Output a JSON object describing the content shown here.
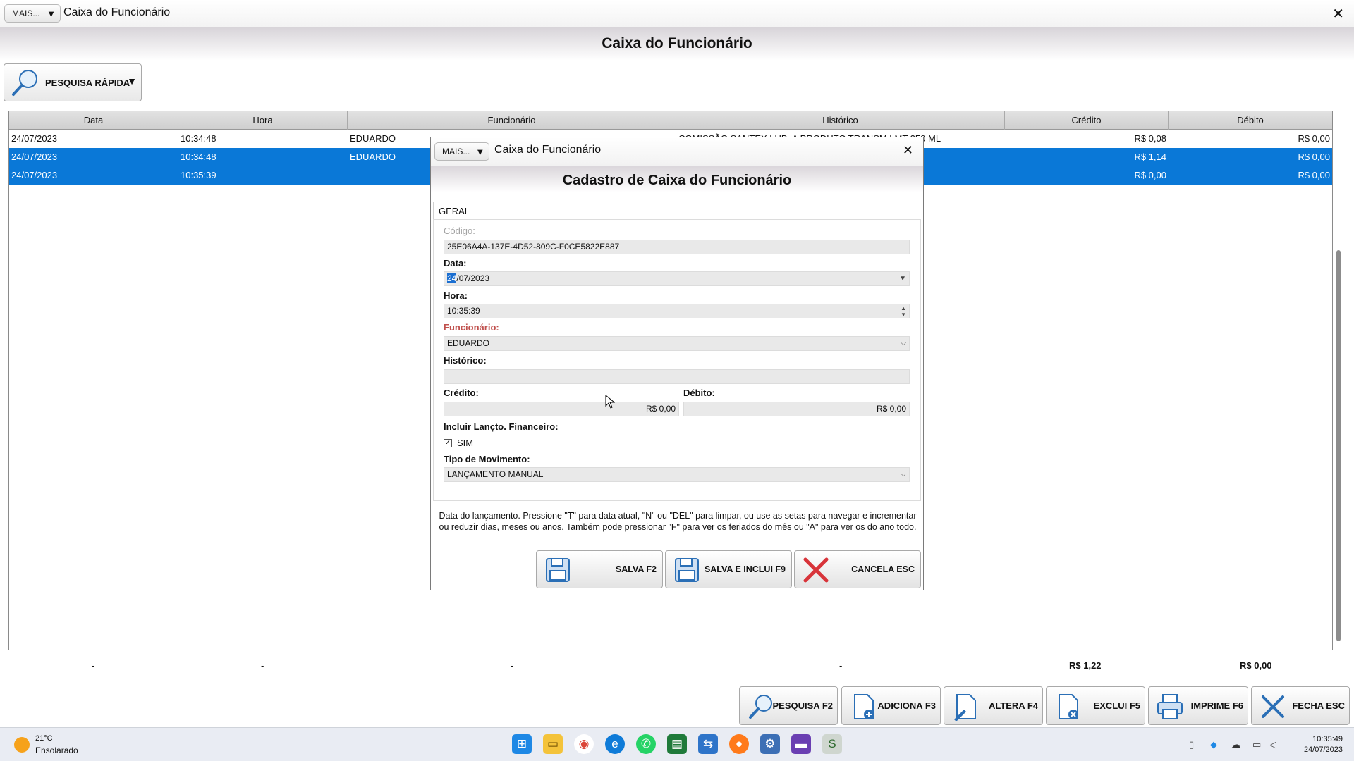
{
  "window": {
    "mais_label": "MAIS...",
    "title": "Caixa do Funcionário",
    "close": "✕",
    "heading": "Caixa do Funcionário"
  },
  "quick_search": {
    "label": "PESQUISA RÁPIDA",
    "arrow": "▼"
  },
  "grid": {
    "columns": [
      "Data",
      "Hora",
      "Funcionário",
      "Histórico",
      "Crédito",
      "Débito"
    ],
    "rows": [
      {
        "data": "24/07/2023",
        "hora": "10:34:48",
        "funcionario": "EDUARDO",
        "historico": "COMISSÃO SANTEX LUB. A PRODUTO TRANSM LMT 250 ML",
        "credito": "R$ 0,08",
        "debito": "R$ 0,00",
        "selected": false
      },
      {
        "data": "24/07/2023",
        "hora": "10:34:48",
        "funcionario": "EDUARDO",
        "historico": "",
        "credito": "R$ 1,14",
        "debito": "R$ 0,00",
        "selected": true
      },
      {
        "data": "24/07/2023",
        "hora": "10:35:39",
        "funcionario": "",
        "historico": "",
        "credito": "R$ 0,00",
        "debito": "R$ 0,00",
        "selected": true
      }
    ]
  },
  "totals": {
    "data": "-",
    "hora": "-",
    "funcionario": "-",
    "historico": "-",
    "credito": "R$ 1,22",
    "debito": "R$ 0,00"
  },
  "actions": {
    "pesquisa": "PESQUISA F2",
    "adiciona": "ADICIONA F3",
    "altera": "ALTERA F4",
    "exclui": "EXCLUI F5",
    "imprime": "IMPRIME F6",
    "fecha": "FECHA ESC"
  },
  "dialog": {
    "mais_label": "MAIS...",
    "title": "Caixa do Funcionário",
    "close": "✕",
    "heading": "Cadastro de Caixa do Funcionário",
    "tab": "GERAL",
    "fields": {
      "codigo_label": "Código:",
      "codigo_value": "25E06A4A-137E-4D52-809C-F0CE5822E887",
      "data_label": "Data:",
      "data_value_day": "24",
      "data_value_rest": "/07/2023",
      "hora_label": "Hora:",
      "hora_value": "10:35:39",
      "funcionario_label": "Funcionário:",
      "funcionario_value": "EDUARDO",
      "historico_label": "Histórico:",
      "historico_value": "",
      "credito_label": "Crédito:",
      "credito_value": "R$ 0,00",
      "debito_label": "Débito:",
      "debito_value": "R$ 0,00",
      "incluir_label": "Incluir Lançto. Financeiro:",
      "incluir_option": "SIM",
      "incluir_checked": true,
      "tipo_label": "Tipo de Movimento:",
      "tipo_value": "LANÇAMENTO MANUAL"
    },
    "hint": "Data do lançamento. Pressione \"T\" para data atual, \"N\" ou \"DEL\" para limpar, ou use as setas para navegar e incrementar ou reduzir dias, meses ou anos. Também pode pressionar \"F\" para ver os feriados do mês ou \"A\" para ver os do ano todo.",
    "buttons": {
      "salva": "SALVA F2",
      "salva_inclui": "SALVA E INCLUI F9",
      "cancela": "CANCELA ESC"
    }
  },
  "taskbar": {
    "weather_temp": "21°C",
    "weather_desc": "Ensolarado",
    "clock_time": "10:35:49",
    "clock_date": "24/07/2023"
  },
  "colors": {
    "selection": "#0a78d7",
    "required_label": "#c0504d",
    "cancel_red": "#d8343a"
  }
}
